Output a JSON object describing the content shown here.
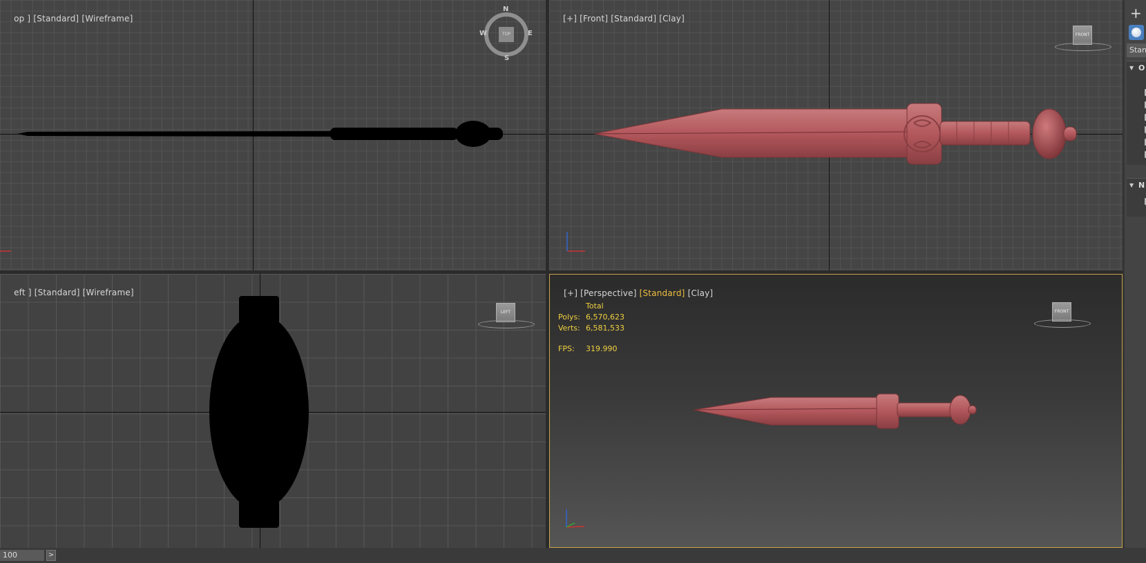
{
  "viewports": {
    "top": {
      "plus": "",
      "name": "op ]",
      "shading": "[Standard]",
      "mode": "[Wireframe]"
    },
    "front": {
      "plus": "[+]",
      "name": "[Front]",
      "shading": "[Standard]",
      "mode": "[Clay]"
    },
    "left": {
      "plus": "",
      "name": "eft ]",
      "shading": "[Standard]",
      "mode": "[Wireframe]"
    },
    "perspective": {
      "plus": "[+]",
      "name": "[Perspective]",
      "shading": "[Standard]",
      "mode": "[Clay]",
      "stats": {
        "header": "Total",
        "polys_label": "Polys:",
        "polys_value": "6,570,623",
        "verts_label": "Verts:",
        "verts_value": "6,581,533",
        "fps_label": "FPS:",
        "fps_value": "319.990"
      }
    }
  },
  "viewcube": {
    "top": "TOP",
    "front": "FRONT",
    "left": "LEFT"
  },
  "compass": {
    "n": "N",
    "s": "S",
    "e": "E",
    "w": "W"
  },
  "side_panel": {
    "dropdown": "Stan",
    "rollout1": "O",
    "rollout2": "N"
  },
  "bottom": {
    "frame_value": "100",
    "next_label": ">"
  },
  "colors": {
    "clay": "#b35a5e",
    "active_border": "#c8a64a",
    "stats": "#f0d040"
  }
}
